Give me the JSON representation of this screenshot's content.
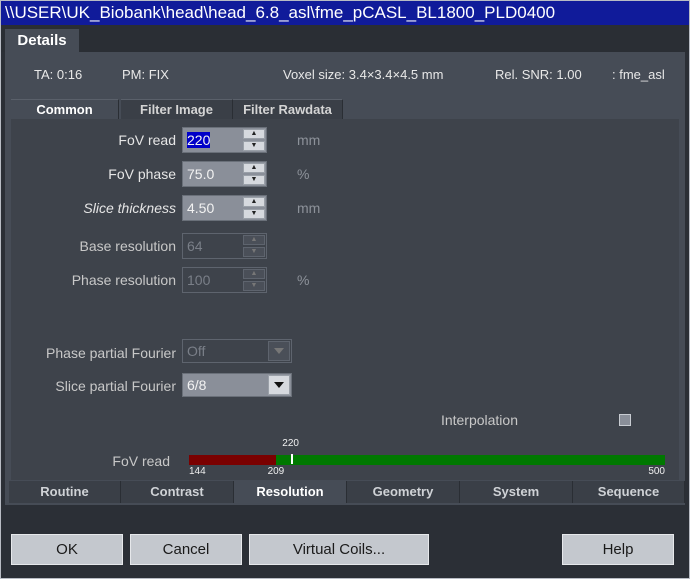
{
  "window": {
    "title": "\\\\USER\\UK_Biobank\\head\\head_6.8_asl\\fme_pCASL_BL1800_PLD0400"
  },
  "details_tab": "Details",
  "info": {
    "ta": "TA: 0:16",
    "pm": "PM: FIX",
    "voxel": "Voxel size: 3.4×3.4×4.5 mm",
    "snr": "Rel. SNR: 1.00",
    "seq": ": fme_asl"
  },
  "subtabs": [
    "Common",
    "Filter Image",
    "Filter Rawdata"
  ],
  "params": {
    "fov_read": {
      "label": "FoV read",
      "value": "220",
      "unit": "mm"
    },
    "fov_phase": {
      "label": "FoV phase",
      "value": "75.0",
      "unit": "%"
    },
    "slice_thickness": {
      "label": "Slice thickness",
      "value": "4.50",
      "unit": "mm"
    },
    "base_resolution": {
      "label": "Base resolution",
      "value": "64"
    },
    "phase_resolution": {
      "label": "Phase resolution",
      "value": "100",
      "unit": "%"
    },
    "phase_partial_fourier": {
      "label": "Phase partial Fourier",
      "value": "Off"
    },
    "slice_partial_fourier": {
      "label": "Slice partial Fourier",
      "value": "6/8"
    },
    "interpolation": {
      "label": "Interpolation",
      "checked": false
    }
  },
  "range_bar": {
    "label": "FoV read",
    "min": "144",
    "limit": "209",
    "current": "220",
    "max": "500",
    "min_value": 144,
    "limit_value": 209,
    "current_value": 220,
    "max_value": 500,
    "colors": {
      "invalid": "#7a0000",
      "valid": "#007800"
    }
  },
  "bottom_tabs": [
    "Routine",
    "Contrast",
    "Resolution",
    "Geometry",
    "System",
    "Sequence"
  ],
  "active_bottom_tab": "Resolution",
  "buttons": {
    "ok": "OK",
    "cancel": "Cancel",
    "virtual_coils": "Virtual Coils...",
    "help": "Help"
  }
}
